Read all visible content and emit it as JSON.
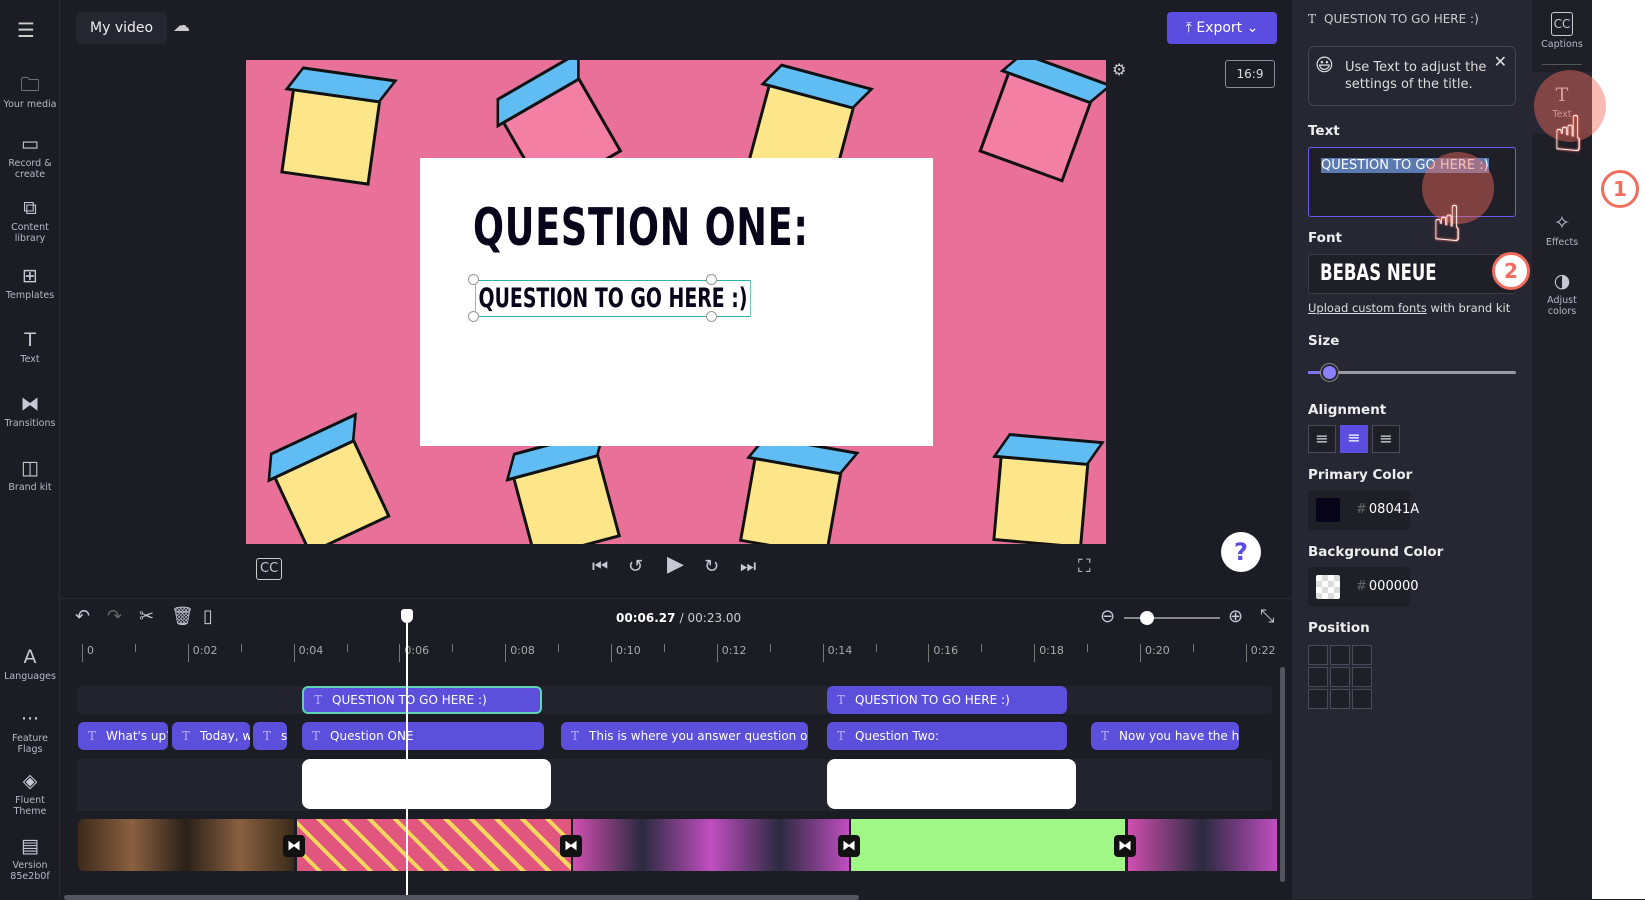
{
  "app": {
    "title": "My video",
    "export_label": "Export",
    "aspect_ratio": "16:9"
  },
  "leftnav": [
    {
      "label": "Your media",
      "icon": "folder-icon"
    },
    {
      "label": "Record & create",
      "icon": "camera-icon"
    },
    {
      "label": "Content library",
      "icon": "library-icon"
    },
    {
      "label": "Templates",
      "icon": "templates-icon"
    },
    {
      "label": "Text",
      "icon": "text-icon"
    },
    {
      "label": "Transitions",
      "icon": "transitions-icon"
    },
    {
      "label": "Brand kit",
      "icon": "brand-kit-icon"
    },
    {
      "label": "Languages",
      "icon": "languages-icon"
    },
    {
      "label": "Feature Flags",
      "icon": "more-icon"
    },
    {
      "label": "Fluent Theme",
      "icon": "theme-icon"
    },
    {
      "label": "Version 85e2b0f",
      "icon": "archive-icon"
    }
  ],
  "preview": {
    "heading": "QUESTION ONE:",
    "subheading": "QUESTION TO GO HERE :)",
    "bg_color": "#e97199"
  },
  "timeline": {
    "current_time": "00:06.27",
    "total_time": "/ 00:23.00",
    "ticks": [
      "0",
      "0:02",
      "0:04",
      "0:06",
      "0:08",
      "0:10",
      "0:12",
      "0:14",
      "0:16",
      "0:18",
      "0:20",
      "0:22"
    ],
    "title_clips": [
      "QUESTION TO GO HERE :)",
      "QUESTION TO GO HERE :)"
    ],
    "text_clips": [
      "What's up?",
      "Today, w",
      "s",
      "Question ONE",
      "This is where you answer question one",
      "Question Two:",
      "Now you have the ha"
    ]
  },
  "panel": {
    "header": "QUESTION TO GO HERE :)",
    "tip": "Use Text to adjust the settings of the title.",
    "text_label": "Text",
    "text_value": "QUESTION TO GO HERE :)",
    "font_label": "Font",
    "font_value": "BEBAS NEUE",
    "upload_link": "Upload custom fonts",
    "upload_suffix": " with brand kit",
    "size_label": "Size",
    "size_value_fraction": 0.1,
    "alignment_label": "Alignment",
    "alignment_selected": "center",
    "primary_label": "Primary Color",
    "primary_value": "08041A",
    "background_label": "Background Color",
    "background_value": "000000",
    "position_label": "Position"
  },
  "rail": [
    {
      "label": "Captions",
      "icon": "captions-icon"
    },
    {
      "label": "Text",
      "icon": "text-icon"
    },
    {
      "label": "Effects",
      "icon": "effects-icon"
    },
    {
      "label": "Adjust colors",
      "icon": "adjust-colors-icon"
    }
  ],
  "annotations": [
    "1",
    "2"
  ],
  "colors": {
    "accent": "#5b4de0",
    "primary_text": "#08041A",
    "annotation": "#f26b5b"
  }
}
